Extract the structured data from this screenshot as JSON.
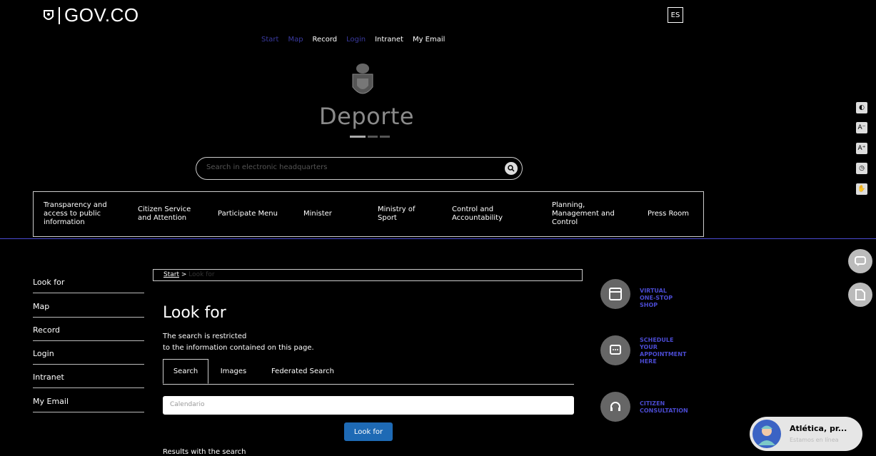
{
  "header": {
    "gov_logo": "GOV.CO",
    "lang": "ES",
    "topnav": [
      {
        "label": "Start",
        "dim": true
      },
      {
        "label": "Map",
        "dim": true
      },
      {
        "label": "Record",
        "dim": false
      },
      {
        "label": "Login",
        "dim": true
      },
      {
        "label": "Intranet",
        "dim": false
      },
      {
        "label": "My Email",
        "dim": false
      }
    ],
    "brand": "Deporte",
    "search_placeholder": "Search in electronic headquarters"
  },
  "mainnav": [
    "Transparency and access to public information",
    "Citizen Service and Attention",
    "Participate Menu",
    "Minister",
    "Ministry of Sport",
    "Control and Accountability",
    "Planning, Management and Control",
    "Press Room"
  ],
  "sidebar": [
    "Look for",
    "Map",
    "Record",
    "Login",
    "Intranet",
    "My Email"
  ],
  "breadcrumb": {
    "start": "Start",
    "current": "Look for"
  },
  "content": {
    "title": "Look for",
    "desc_line1": "The search is restricted",
    "desc_line2": "to the information contained on this page.",
    "tabs": [
      "Search",
      "Images",
      "Federated Search"
    ],
    "search_placeholder": "Calendario",
    "button": "Look for",
    "results": "Results with the search"
  },
  "services": [
    {
      "label": "VIRTUAL ONE-STOP SHOP",
      "icon": "window-icon"
    },
    {
      "label": "SCHEDULE YOUR APPOINTMENT HERE",
      "icon": "chat-icon"
    },
    {
      "label": "CITIZEN CONSULTATION",
      "icon": "headset-icon"
    }
  ],
  "chat": {
    "name": "Atlética, pr...",
    "sub": "Estamos en línea"
  },
  "colors": {
    "accent": "#4a4ad0",
    "button": "#1e6ab5"
  }
}
